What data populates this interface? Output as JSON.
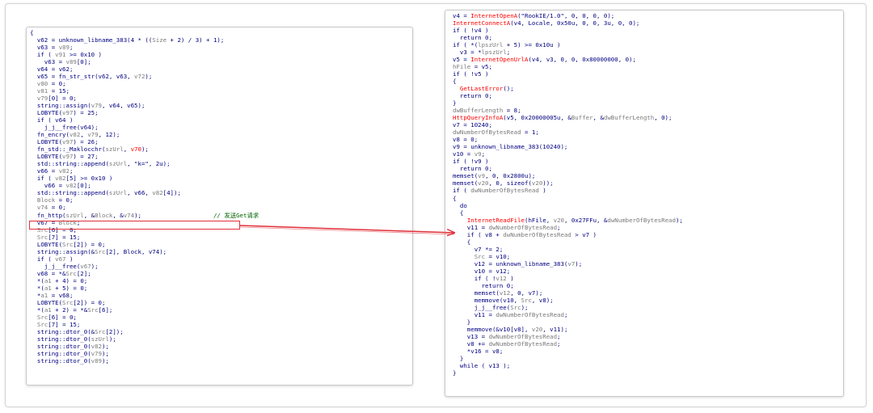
{
  "colors": {
    "plain": "#000080",
    "variable": "#008000",
    "api": "#ff0000",
    "comment": "#006400",
    "gray": "#7a7a7a",
    "highlight": "#e0303a"
  },
  "left_panel": {
    "lines": [
      [
        [
          "{",
          "plain"
        ]
      ],
      [
        [
          "  v62 = unknown_libname_383(4 * ((",
          "plain"
        ],
        [
          "Size",
          "gray"
        ],
        [
          " + 2) / 3) + 1);",
          "plain"
        ]
      ],
      [
        [
          "  v63 = ",
          "plain"
        ],
        [
          "v89",
          "gray"
        ],
        [
          ";",
          "plain"
        ]
      ],
      [
        [
          "  if ( ",
          "plain"
        ],
        [
          "v91",
          "gray"
        ],
        [
          " >= 0x10 )",
          "plain"
        ]
      ],
      [
        [
          "    v63 = ",
          "plain"
        ],
        [
          "v89",
          "gray"
        ],
        [
          "[0];",
          "plain"
        ]
      ],
      [
        [
          "  v64 = ",
          "plain"
        ],
        [
          "v62",
          "plain"
        ],
        [
          ";",
          "plain"
        ]
      ],
      [
        [
          "  v65 = fn_str_str(v62, v63, ",
          "plain"
        ],
        [
          "v72",
          "gray"
        ],
        [
          ");",
          "plain"
        ]
      ],
      [
        [
          "  ",
          "plain"
        ],
        [
          "v80",
          "gray"
        ],
        [
          " = 0;",
          "plain"
        ]
      ],
      [
        [
          "  ",
          "plain"
        ],
        [
          "v81",
          "gray"
        ],
        [
          " = 15;",
          "plain"
        ]
      ],
      [
        [
          "  ",
          "plain"
        ],
        [
          "v79",
          "gray"
        ],
        [
          "[0] = 0;",
          "plain"
        ]
      ],
      [
        [
          "  string::assign(",
          "plain"
        ],
        [
          "v79",
          "gray"
        ],
        [
          ", v64, v65);",
          "plain"
        ]
      ],
      [
        [
          "  LOBYTE(",
          "plain"
        ],
        [
          "v97",
          "gray"
        ],
        [
          ") = 25;",
          "plain"
        ]
      ],
      [
        [
          "  if ( v64 )",
          "plain"
        ]
      ],
      [
        [
          "    j_j__free(v64);",
          "plain"
        ]
      ],
      [
        [
          "  fn_encry(",
          "plain"
        ],
        [
          "v82",
          "gray"
        ],
        [
          ", ",
          "plain"
        ],
        [
          "v79",
          "gray"
        ],
        [
          ", 12);",
          "plain"
        ]
      ],
      [
        [
          "  LOBYTE(",
          "plain"
        ],
        [
          "v97",
          "gray"
        ],
        [
          ") = 26;",
          "plain"
        ]
      ],
      [
        [
          "  fn_std::_Maklocchr(",
          "plain"
        ],
        [
          "szUrl",
          "gray"
        ],
        [
          ", ",
          "plain"
        ],
        [
          "v70",
          "api"
        ],
        [
          ");",
          "plain"
        ]
      ],
      [
        [
          "  LOBYTE(",
          "plain"
        ],
        [
          "v97",
          "gray"
        ],
        [
          ") = 27;",
          "plain"
        ]
      ],
      [
        [
          "  std::string::append(",
          "plain"
        ],
        [
          "szUrl",
          "gray"
        ],
        [
          ", \"k=\", 2u);",
          "plain"
        ]
      ],
      [
        [
          "  v66 = ",
          "plain"
        ],
        [
          "v82",
          "gray"
        ],
        [
          ";",
          "plain"
        ]
      ],
      [
        [
          "  if ( ",
          "plain"
        ],
        [
          "v82",
          "gray"
        ],
        [
          "[5] >= 0x10 )",
          "plain"
        ]
      ],
      [
        [
          "    v66 = ",
          "plain"
        ],
        [
          "v82",
          "gray"
        ],
        [
          "[0];",
          "plain"
        ]
      ],
      [
        [
          "  std::string::append(",
          "plain"
        ],
        [
          "szUrl",
          "gray"
        ],
        [
          ", v66, ",
          "plain"
        ],
        [
          "v82",
          "gray"
        ],
        [
          "[4]);",
          "plain"
        ]
      ],
      [
        [
          "  ",
          "plain"
        ],
        [
          "Block",
          "gray"
        ],
        [
          " = 0;",
          "plain"
        ]
      ],
      [
        [
          "  ",
          "plain"
        ],
        [
          "v74",
          "gray"
        ],
        [
          " = 0;",
          "plain"
        ]
      ],
      [
        [
          "  fn_http(",
          "plain"
        ],
        [
          "szUrl",
          "gray"
        ],
        [
          ", &",
          "plain"
        ],
        [
          "Block",
          "gray"
        ],
        [
          ", &",
          "plain"
        ],
        [
          "v74",
          "gray"
        ],
        [
          ");",
          "plain"
        ],
        [
          "                    // 发送Get请求",
          "comment"
        ]
      ],
      [
        [
          "  v67 = ",
          "plain"
        ],
        [
          "Block",
          "gray"
        ],
        [
          ";",
          "plain"
        ]
      ],
      [
        [
          "  ",
          "plain"
        ],
        [
          "Src",
          "gray"
        ],
        [
          "[6] = 0;",
          "plain"
        ]
      ],
      [
        [
          "  ",
          "plain"
        ],
        [
          "Src",
          "gray"
        ],
        [
          "[7] = 15;",
          "plain"
        ]
      ],
      [
        [
          "  LOBYTE(",
          "plain"
        ],
        [
          "Src",
          "gray"
        ],
        [
          "[2]) = 0;",
          "plain"
        ]
      ],
      [
        [
          "  string::assign(&",
          "plain"
        ],
        [
          "Src",
          "gray"
        ],
        [
          "[2], Block, v74);",
          "plain"
        ]
      ],
      [
        [
          "  if ( ",
          "plain"
        ],
        [
          "v67",
          "gray"
        ],
        [
          " )",
          "plain"
        ]
      ],
      [
        [
          "    j_j__free(",
          "plain"
        ],
        [
          "v67",
          "gray"
        ],
        [
          ");",
          "plain"
        ]
      ],
      [
        [
          "  v68 = *&",
          "plain"
        ],
        [
          "Src",
          "gray"
        ],
        [
          "[2];",
          "plain"
        ]
      ],
      [
        [
          "  *(",
          "plain"
        ],
        [
          "a1",
          "gray"
        ],
        [
          " + 4) = 0;",
          "plain"
        ]
      ],
      [
        [
          "  *(",
          "plain"
        ],
        [
          "a1",
          "gray"
        ],
        [
          " + 5) = 0;",
          "plain"
        ]
      ],
      [
        [
          "  *",
          "plain"
        ],
        [
          "a1",
          "gray"
        ],
        [
          " = v68;",
          "plain"
        ]
      ],
      [
        [
          "  LOBYTE(",
          "plain"
        ],
        [
          "Src",
          "gray"
        ],
        [
          "[2]) = 0;",
          "plain"
        ]
      ],
      [
        [
          "  *(",
          "plain"
        ],
        [
          "a1",
          "gray"
        ],
        [
          " + 2) = *&",
          "plain"
        ],
        [
          "Src",
          "gray"
        ],
        [
          "[6];",
          "plain"
        ]
      ],
      [
        [
          "  ",
          "plain"
        ],
        [
          "Src",
          "gray"
        ],
        [
          "[6] = 0;",
          "plain"
        ]
      ],
      [
        [
          "  ",
          "plain"
        ],
        [
          "Src",
          "gray"
        ],
        [
          "[7] = 15;",
          "plain"
        ]
      ],
      [
        [
          "  string::dtor_0(&",
          "plain"
        ],
        [
          "Src",
          "gray"
        ],
        [
          "[2]);",
          "plain"
        ]
      ],
      [
        [
          "  string::dtor_0(",
          "plain"
        ],
        [
          "szUrl",
          "gray"
        ],
        [
          ");",
          "plain"
        ]
      ],
      [
        [
          "  string::dtor_0(",
          "plain"
        ],
        [
          "v82",
          "gray"
        ],
        [
          ");",
          "plain"
        ]
      ],
      [
        [
          "  string::dtor_0(",
          "plain"
        ],
        [
          "v79",
          "gray"
        ],
        [
          ");",
          "plain"
        ]
      ],
      [
        [
          "  string::dtor_0(",
          "plain"
        ],
        [
          "v89",
          "gray"
        ],
        [
          ");",
          "plain"
        ]
      ]
    ]
  },
  "right_panel": {
    "lines": [
      [
        [
          "v4 = ",
          "plain"
        ],
        [
          "InternetOpenA",
          "api"
        ],
        [
          "(\"RookIE/1.0\", 0, 0, 0, 0);",
          "plain"
        ]
      ],
      [
        [
          "",
          "plain"
        ],
        [
          "InternetConnectA",
          "api"
        ],
        [
          "(v4, Locale, 0x50u, 0, 0, 3u, 0, 0);",
          "plain"
        ]
      ],
      [
        [
          "if ( !v4 )",
          "plain"
        ]
      ],
      [
        [
          "  return 0;",
          "plain"
        ]
      ],
      [
        [
          "if ( *(",
          "plain"
        ],
        [
          "lpszUrl",
          "gray"
        ],
        [
          " + 5) >= 0x10u )",
          "plain"
        ]
      ],
      [
        [
          "  v3 = *",
          "plain"
        ],
        [
          "lpszUrl",
          "gray"
        ],
        [
          ";",
          "plain"
        ]
      ],
      [
        [
          "v5 = ",
          "plain"
        ],
        [
          "InternetOpenUrlA",
          "api"
        ],
        [
          "(v4, v3, 0, 0, 0x80000000, 0);",
          "plain"
        ]
      ],
      [
        [
          "",
          "plain"
        ],
        [
          "hFile",
          "gray"
        ],
        [
          " = v5;",
          "plain"
        ]
      ],
      [
        [
          "if ( !v5 )",
          "plain"
        ]
      ],
      [
        [
          "{",
          "plain"
        ]
      ],
      [
        [
          "  ",
          "plain"
        ],
        [
          "GetLastError",
          "api"
        ],
        [
          "();",
          "plain"
        ]
      ],
      [
        [
          "  return 0;",
          "plain"
        ]
      ],
      [
        [
          "}",
          "plain"
        ]
      ],
      [
        [
          "",
          "plain"
        ],
        [
          "dwBufferLength",
          "gray"
        ],
        [
          " = 8;",
          "plain"
        ]
      ],
      [
        [
          "",
          "plain"
        ],
        [
          "HttpQueryInfoA",
          "api"
        ],
        [
          "(v5, 0x20000005u, &",
          "plain"
        ],
        [
          "Buffer",
          "gray"
        ],
        [
          ", &",
          "plain"
        ],
        [
          "dwBufferLength",
          "gray"
        ],
        [
          ", 0);",
          "plain"
        ]
      ],
      [
        [
          "v7 = 10240;",
          "plain"
        ]
      ],
      [
        [
          "",
          "plain"
        ],
        [
          "dwNumberOfBytesRead",
          "gray"
        ],
        [
          " = 1;",
          "plain"
        ]
      ],
      [
        [
          "v8 = 0;",
          "plain"
        ]
      ],
      [
        [
          "v9 = unknown_libname_383(10240);",
          "plain"
        ]
      ],
      [
        [
          "v10 = ",
          "plain"
        ],
        [
          "v9",
          "gray"
        ],
        [
          ";",
          "plain"
        ]
      ],
      [
        [
          "if ( !v9 )",
          "plain"
        ]
      ],
      [
        [
          "  return 0;",
          "plain"
        ]
      ],
      [
        [
          "memset(",
          "plain"
        ],
        [
          "v9",
          "gray"
        ],
        [
          ", 0, 0x2800u);",
          "plain"
        ]
      ],
      [
        [
          "memset(",
          "plain"
        ],
        [
          "v20",
          "gray"
        ],
        [
          ", 0, sizeof(",
          "plain"
        ],
        [
          "v20",
          "gray"
        ],
        [
          "));",
          "plain"
        ]
      ],
      [
        [
          "if ( ",
          "plain"
        ],
        [
          "dwNumberOfBytesRead",
          "gray"
        ],
        [
          " )",
          "plain"
        ]
      ],
      [
        [
          "{",
          "plain"
        ]
      ],
      [
        [
          "  do",
          "plain"
        ]
      ],
      [
        [
          "  {",
          "plain"
        ]
      ],
      [
        [
          "    ",
          "plain"
        ],
        [
          "InternetReadFile",
          "api"
        ],
        [
          "(hFile, ",
          "plain"
        ],
        [
          "v20",
          "gray"
        ],
        [
          ", 0x27FFu, &",
          "plain"
        ],
        [
          "dwNumberOfBytesRead",
          "gray"
        ],
        [
          ");",
          "plain"
        ]
      ],
      [
        [
          "    v11 = ",
          "plain"
        ],
        [
          "dwNumberOfBytesRead",
          "gray"
        ],
        [
          ";",
          "plain"
        ]
      ],
      [
        [
          "    if ( v8 + ",
          "plain"
        ],
        [
          "dwNumberOfBytesRead",
          "gray"
        ],
        [
          " > v7 )",
          "plain"
        ]
      ],
      [
        [
          "    {",
          "plain"
        ]
      ],
      [
        [
          "      v7 *= 2;",
          "plain"
        ]
      ],
      [
        [
          "      ",
          "plain"
        ],
        [
          "Src",
          "gray"
        ],
        [
          " = v10;",
          "plain"
        ]
      ],
      [
        [
          "      v12 = unknown_libname_383(",
          "plain"
        ],
        [
          "v7",
          "gray"
        ],
        [
          ");",
          "plain"
        ]
      ],
      [
        [
          "      v10 = v12;",
          "plain"
        ]
      ],
      [
        [
          "      if ( !",
          "plain"
        ],
        [
          "v12",
          "gray"
        ],
        [
          " )",
          "plain"
        ]
      ],
      [
        [
          "        return 0;",
          "plain"
        ]
      ],
      [
        [
          "      memset(",
          "plain"
        ],
        [
          "v12",
          "gray"
        ],
        [
          ", 0, v7);",
          "plain"
        ]
      ],
      [
        [
          "      memmove(v10, ",
          "plain"
        ],
        [
          "Src",
          "gray"
        ],
        [
          ", v8);",
          "plain"
        ]
      ],
      [
        [
          "      j_j__free(",
          "plain"
        ],
        [
          "Src",
          "gray"
        ],
        [
          ");",
          "plain"
        ]
      ],
      [
        [
          "      v11 = ",
          "plain"
        ],
        [
          "dwNumberOfBytesRead",
          "gray"
        ],
        [
          ";",
          "plain"
        ]
      ],
      [
        [
          "    }",
          "plain"
        ]
      ],
      [
        [
          "    memmove(&v10[v8], ",
          "plain"
        ],
        [
          "v20",
          "gray"
        ],
        [
          ", v11);",
          "plain"
        ]
      ],
      [
        [
          "    v13 = ",
          "plain"
        ],
        [
          "dwNumberOfBytesRead",
          "gray"
        ],
        [
          ";",
          "plain"
        ]
      ],
      [
        [
          "    v8 += ",
          "plain"
        ],
        [
          "dwNumberOfBytesRead",
          "gray"
        ],
        [
          ";",
          "plain"
        ]
      ],
      [
        [
          "    *v16 = v8;",
          "plain"
        ]
      ],
      [
        [
          "  }",
          "plain"
        ]
      ],
      [
        [
          "  while ( v13 );",
          "plain"
        ]
      ],
      [
        [
          "}",
          "plain"
        ]
      ]
    ]
  }
}
